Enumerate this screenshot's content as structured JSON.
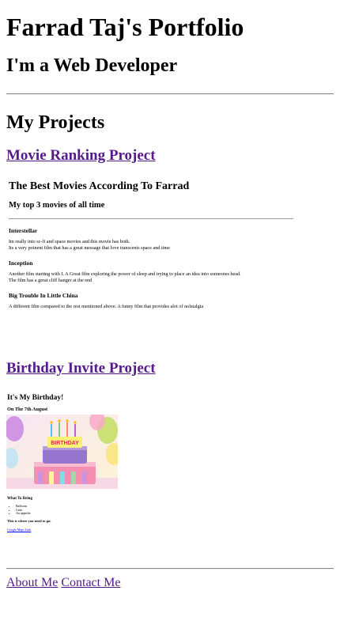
{
  "header": {
    "title": "Farrad Taj's Portfolio",
    "subtitle": "I'm a Web Developer"
  },
  "projects": {
    "heading": "My Projects",
    "items": [
      {
        "title": "Movie Ranking Project",
        "thumbnail": {
          "heading": "The Best Movies According To Farrad",
          "subheading": "My top 3 movies of all time",
          "movies": [
            {
              "name": "Interstellar",
              "lines": [
                "Im really into sc-fi and space movies and this movie has both.",
                "Its a very poinent film that has a great message that love transcents space and time"
              ]
            },
            {
              "name": "Inception",
              "lines": [
                "Another film starting with I. A Great film exploring the power of sleep and trying to place an idea into someones head.",
                "The film has a great cliff hanger at the end"
              ]
            },
            {
              "name": "Big Trouble In Little China",
              "lines": [
                "A different film compared to the rest mentioned above. A funny film that provides alot of nolstalgia"
              ]
            }
          ]
        }
      },
      {
        "title": "Birthday Invite Project",
        "thumbnail": {
          "heading": "It's My Birthday!",
          "subheading": "On The 7th August",
          "cake_text": "BIRTHDAY",
          "bring_heading": "What To Bring",
          "bring_items": [
            "Balloons",
            "Cake",
            "An appetite"
          ],
          "where_text": "This is where you need to go:",
          "map_link": "Google Maps Link"
        }
      }
    ]
  },
  "footer": {
    "about": "About Me",
    "contact": "Contact Me"
  },
  "colors": {
    "visited_link": "#551a8b",
    "link": "#0000ee",
    "rule": "#8a8a8a"
  }
}
